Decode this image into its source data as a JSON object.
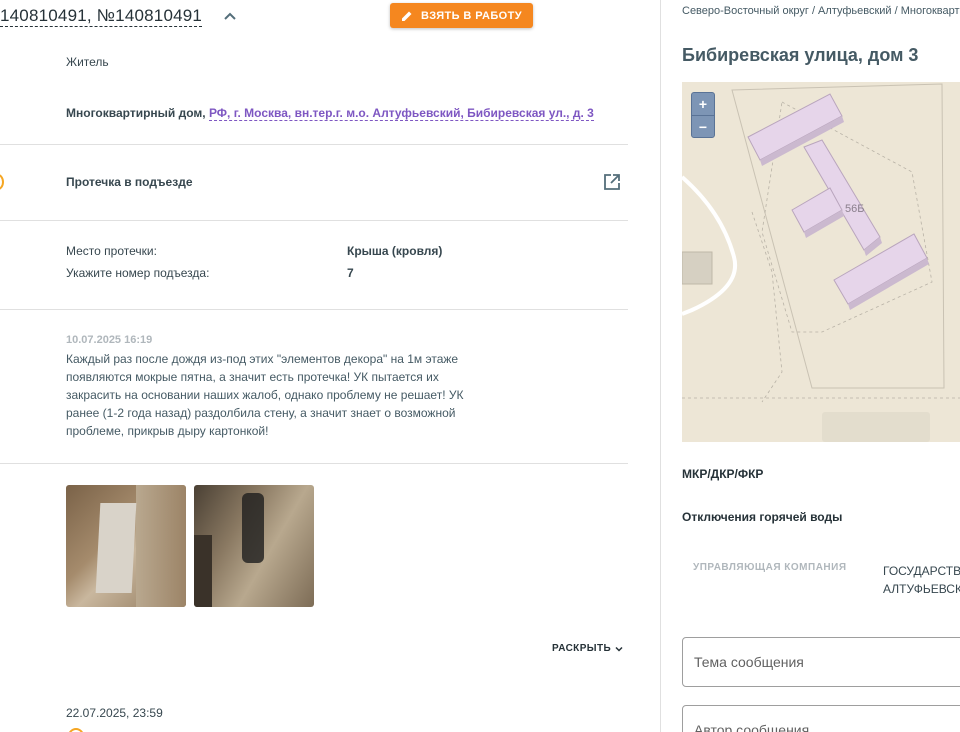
{
  "header": {
    "title": "140810491, №140810491",
    "take_button": "ВЗЯТЬ В РАБОТУ"
  },
  "request": {
    "author_role": "Житель",
    "building_type": "Многоквартирный дом,",
    "address": "РФ, г. Москва, вн.тер.г. м.о. Алтуфьевский, Бибиревская ул., д. 3",
    "category": "Протечка в подъезде",
    "fields": [
      {
        "label": "Место протечки:",
        "value": "Крыша (кровля)"
      },
      {
        "label": "Укажите номер подъезда:",
        "value": "7"
      }
    ],
    "comment_date": "10.07.2025 16:19",
    "comment_text": "Каждый раз после дождя из-под этих \"элементов декора\" на 1м этаже появляются мокрые пятна, а значит есть протечка! УК пытается их закрасить на основании наших жалоб, однако проблему не решает! УК ранее (1-2 года назад) раздолбила стену, а значит знает о возможной проблеме, прикрыв дыру картонкой!",
    "expand_label": "РАСКРЫТЬ",
    "next_date": "22.07.2025, 23:59"
  },
  "sidebar": {
    "breadcrumbs": "Северо-Восточный округ / Алтуфьевский / Многоквартирный дом",
    "title": "Бибиревская улица, дом 3",
    "map": {
      "building_label": "56Б",
      "zoom_in": "+",
      "zoom_out": "−"
    },
    "program_label": "МКР/ДКР/ФКР",
    "hot_water_label": "Отключения горячей воды",
    "uk_label": "УПРАВЛЯЮЩАЯ КОМПАНИЯ",
    "uk_value_line1": "ГОСУДАРСТВЕННОЕ",
    "uk_value_line2": "АЛТУФЬЕВСКОГО",
    "subject_placeholder": "Тема сообщения",
    "author_placeholder": "Автор сообщения"
  },
  "colors": {
    "accent": "#f5871f",
    "link": "#7e57c2",
    "building": "#e6d5ea",
    "map_bg": "#ede6d6"
  }
}
